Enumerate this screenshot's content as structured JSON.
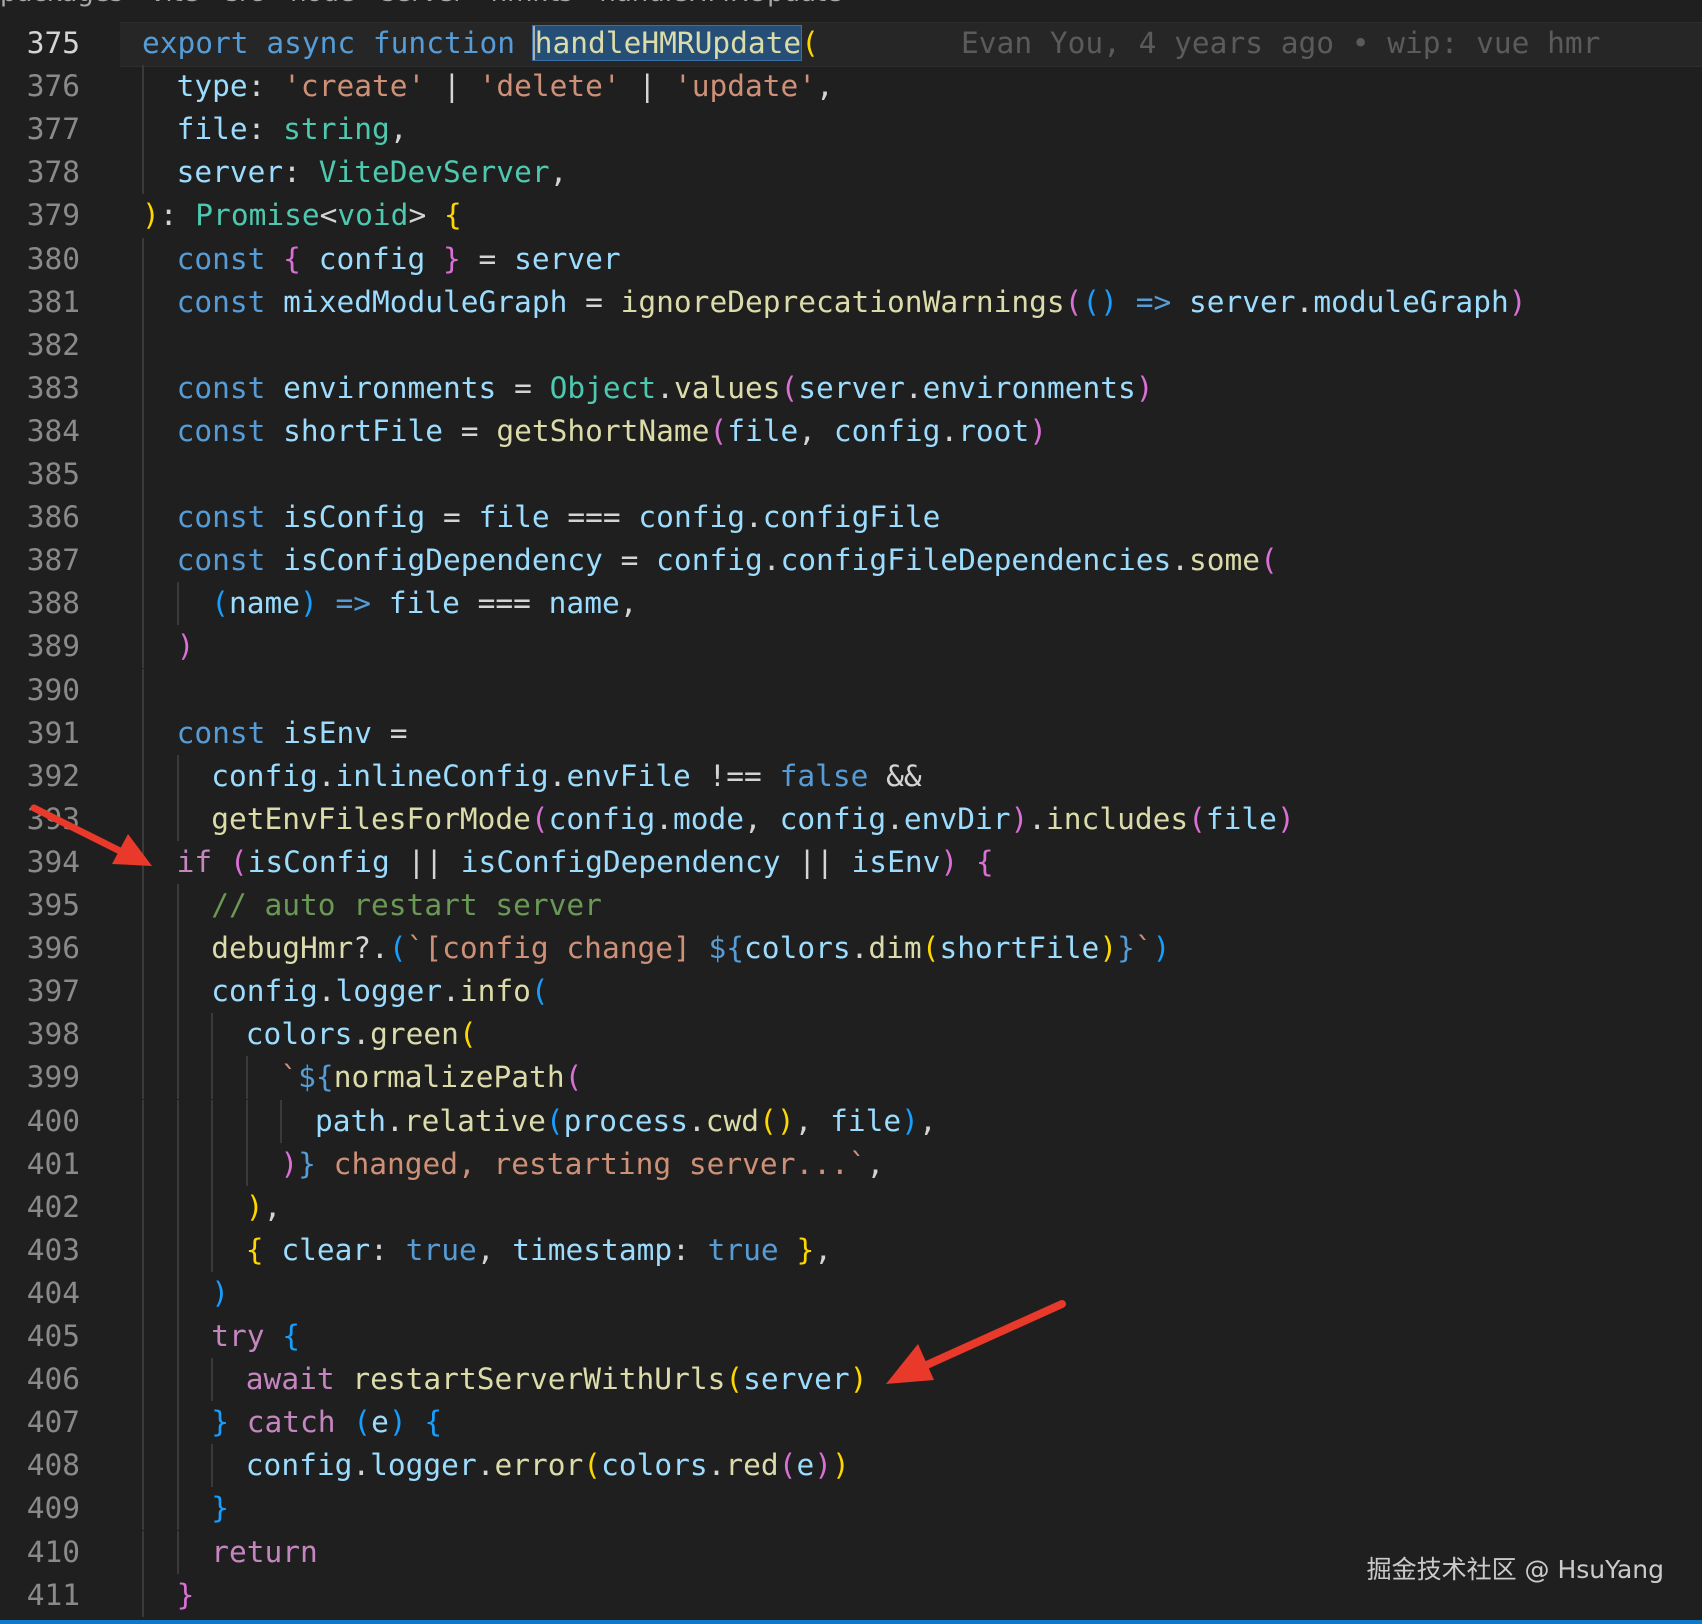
{
  "breadcrumb": {
    "items": [
      "packages",
      "vite",
      "src",
      "node",
      "server",
      "hmr.ts",
      "handleHMRUpdate"
    ]
  },
  "blame": "Evan You, 4 years ago • wip: vue hmr",
  "watermark": "掘金技术社区 @ HsuYang",
  "colors": {
    "keyword": "#569cd6",
    "control": "#c586c0",
    "function": "#dcdcaa",
    "variable": "#9cdcfe",
    "type": "#4ec9b0",
    "string": "#ce9178",
    "comment": "#6a9955",
    "bracket1": "#ffd700",
    "bracket2": "#da70d6",
    "bracket3": "#179fff",
    "arrow": "#e8392b"
  },
  "lines": [
    {
      "n": "375",
      "indent": 0,
      "tokens": [
        [
          "export ",
          "kw"
        ],
        [
          "async ",
          "kw"
        ],
        [
          "function ",
          "kw"
        ],
        [
          "handleHMRUpdate",
          "fnsel"
        ],
        [
          "(",
          "b1"
        ]
      ],
      "blame": true,
      "active": true
    },
    {
      "n": "376",
      "indent": 1,
      "tokens": [
        [
          "type",
          "var"
        ],
        [
          ": ",
          "p"
        ],
        [
          "'create'",
          "str"
        ],
        [
          " | ",
          "p"
        ],
        [
          "'delete'",
          "str"
        ],
        [
          " | ",
          "p"
        ],
        [
          "'update'",
          "str"
        ],
        [
          ",",
          "p"
        ]
      ]
    },
    {
      "n": "377",
      "indent": 1,
      "tokens": [
        [
          "file",
          "var"
        ],
        [
          ": ",
          "p"
        ],
        [
          "string",
          "type"
        ],
        [
          ",",
          "p"
        ]
      ]
    },
    {
      "n": "378",
      "indent": 1,
      "tokens": [
        [
          "server",
          "var"
        ],
        [
          ": ",
          "p"
        ],
        [
          "ViteDevServer",
          "type"
        ],
        [
          ",",
          "p"
        ]
      ]
    },
    {
      "n": "379",
      "indent": 0,
      "tokens": [
        [
          ")",
          "b1"
        ],
        [
          ": ",
          "p"
        ],
        [
          "Promise",
          "type"
        ],
        [
          "<",
          "p"
        ],
        [
          "void",
          "type"
        ],
        [
          "> ",
          "p"
        ],
        [
          "{",
          "b1"
        ]
      ]
    },
    {
      "n": "380",
      "indent": 1,
      "tokens": [
        [
          "const ",
          "kw"
        ],
        [
          "{ ",
          "b2"
        ],
        [
          "config ",
          "var"
        ],
        [
          "}",
          "b2"
        ],
        [
          " = ",
          "p"
        ],
        [
          "server",
          "var"
        ]
      ]
    },
    {
      "n": "381",
      "indent": 1,
      "tokens": [
        [
          "const ",
          "kw"
        ],
        [
          "mixedModuleGraph",
          "var"
        ],
        [
          " = ",
          "p"
        ],
        [
          "ignoreDeprecationWarnings",
          "fn"
        ],
        [
          "(",
          "b2"
        ],
        [
          "()",
          "b3"
        ],
        [
          " => ",
          "kw"
        ],
        [
          "server",
          "var"
        ],
        [
          ".",
          "p"
        ],
        [
          "moduleGraph",
          "var"
        ],
        [
          ")",
          "b2"
        ]
      ]
    },
    {
      "n": "382",
      "indent": 1,
      "tokens": []
    },
    {
      "n": "383",
      "indent": 1,
      "tokens": [
        [
          "const ",
          "kw"
        ],
        [
          "environments",
          "var"
        ],
        [
          " = ",
          "p"
        ],
        [
          "Object",
          "type"
        ],
        [
          ".",
          "p"
        ],
        [
          "values",
          "fn"
        ],
        [
          "(",
          "b2"
        ],
        [
          "server",
          "var"
        ],
        [
          ".",
          "p"
        ],
        [
          "environments",
          "var"
        ],
        [
          ")",
          "b2"
        ]
      ]
    },
    {
      "n": "384",
      "indent": 1,
      "tokens": [
        [
          "const ",
          "kw"
        ],
        [
          "shortFile",
          "var"
        ],
        [
          " = ",
          "p"
        ],
        [
          "getShortName",
          "fn"
        ],
        [
          "(",
          "b2"
        ],
        [
          "file",
          "var"
        ],
        [
          ", ",
          "p"
        ],
        [
          "config",
          "var"
        ],
        [
          ".",
          "p"
        ],
        [
          "root",
          "var"
        ],
        [
          ")",
          "b2"
        ]
      ]
    },
    {
      "n": "385",
      "indent": 1,
      "tokens": []
    },
    {
      "n": "386",
      "indent": 1,
      "tokens": [
        [
          "const ",
          "kw"
        ],
        [
          "isConfig",
          "var"
        ],
        [
          " = ",
          "p"
        ],
        [
          "file",
          "var"
        ],
        [
          " === ",
          "p"
        ],
        [
          "config",
          "var"
        ],
        [
          ".",
          "p"
        ],
        [
          "configFile",
          "var"
        ]
      ]
    },
    {
      "n": "387",
      "indent": 1,
      "tokens": [
        [
          "const ",
          "kw"
        ],
        [
          "isConfigDependency",
          "var"
        ],
        [
          " = ",
          "p"
        ],
        [
          "config",
          "var"
        ],
        [
          ".",
          "p"
        ],
        [
          "configFileDependencies",
          "var"
        ],
        [
          ".",
          "p"
        ],
        [
          "some",
          "fn"
        ],
        [
          "(",
          "b2"
        ]
      ]
    },
    {
      "n": "388",
      "indent": 2,
      "tokens": [
        [
          "(",
          "b3"
        ],
        [
          "name",
          "var"
        ],
        [
          ")",
          "b3"
        ],
        [
          " => ",
          "kw"
        ],
        [
          "file",
          "var"
        ],
        [
          " === ",
          "p"
        ],
        [
          "name",
          "var"
        ],
        [
          ",",
          "p"
        ]
      ]
    },
    {
      "n": "389",
      "indent": 1,
      "tokens": [
        [
          ")",
          "b2"
        ]
      ]
    },
    {
      "n": "390",
      "indent": 1,
      "tokens": []
    },
    {
      "n": "391",
      "indent": 1,
      "tokens": [
        [
          "const ",
          "kw"
        ],
        [
          "isEnv",
          "var"
        ],
        [
          " =",
          "p"
        ]
      ]
    },
    {
      "n": "392",
      "indent": 2,
      "tokens": [
        [
          "config",
          "var"
        ],
        [
          ".",
          "p"
        ],
        [
          "inlineConfig",
          "var"
        ],
        [
          ".",
          "p"
        ],
        [
          "envFile",
          "var"
        ],
        [
          " !== ",
          "p"
        ],
        [
          "false",
          "kw"
        ],
        [
          " &&",
          "p"
        ]
      ]
    },
    {
      "n": "393",
      "indent": 2,
      "tokens": [
        [
          "getEnvFilesForMode",
          "fn"
        ],
        [
          "(",
          "b2"
        ],
        [
          "config",
          "var"
        ],
        [
          ".",
          "p"
        ],
        [
          "mode",
          "var"
        ],
        [
          ", ",
          "p"
        ],
        [
          "config",
          "var"
        ],
        [
          ".",
          "p"
        ],
        [
          "envDir",
          "var"
        ],
        [
          ")",
          "b2"
        ],
        [
          ".",
          "p"
        ],
        [
          "includes",
          "fn"
        ],
        [
          "(",
          "b2"
        ],
        [
          "file",
          "var"
        ],
        [
          ")",
          "b2"
        ]
      ]
    },
    {
      "n": "394",
      "indent": 1,
      "tokens": [
        [
          "if ",
          "ctl"
        ],
        [
          "(",
          "b2"
        ],
        [
          "isConfig",
          "var"
        ],
        [
          " || ",
          "p"
        ],
        [
          "isConfigDependency",
          "var"
        ],
        [
          " || ",
          "p"
        ],
        [
          "isEnv",
          "var"
        ],
        [
          ")",
          "b2"
        ],
        [
          " {",
          "b2"
        ]
      ]
    },
    {
      "n": "395",
      "indent": 2,
      "tokens": [
        [
          "// auto restart server",
          "cm"
        ]
      ]
    },
    {
      "n": "396",
      "indent": 2,
      "tokens": [
        [
          "debugHmr",
          "fn"
        ],
        [
          "?.",
          "p"
        ],
        [
          "(",
          "b3"
        ],
        [
          "`[config change] ",
          "str"
        ],
        [
          "${",
          "kw"
        ],
        [
          "colors",
          "var"
        ],
        [
          ".",
          "p"
        ],
        [
          "dim",
          "fn"
        ],
        [
          "(",
          "b1"
        ],
        [
          "shortFile",
          "var"
        ],
        [
          ")",
          "b1"
        ],
        [
          "}",
          "kw"
        ],
        [
          "`",
          "str"
        ],
        [
          ")",
          "b3"
        ]
      ]
    },
    {
      "n": "397",
      "indent": 2,
      "tokens": [
        [
          "config",
          "var"
        ],
        [
          ".",
          "p"
        ],
        [
          "logger",
          "var"
        ],
        [
          ".",
          "p"
        ],
        [
          "info",
          "fn"
        ],
        [
          "(",
          "b3"
        ]
      ]
    },
    {
      "n": "398",
      "indent": 3,
      "tokens": [
        [
          "colors",
          "var"
        ],
        [
          ".",
          "p"
        ],
        [
          "green",
          "fn"
        ],
        [
          "(",
          "b1"
        ]
      ]
    },
    {
      "n": "399",
      "indent": 4,
      "tokens": [
        [
          "`",
          "str"
        ],
        [
          "${",
          "kw"
        ],
        [
          "normalizePath",
          "fn"
        ],
        [
          "(",
          "b2"
        ]
      ]
    },
    {
      "n": "400",
      "indent": 5,
      "tokens": [
        [
          "path",
          "var"
        ],
        [
          ".",
          "p"
        ],
        [
          "relative",
          "fn"
        ],
        [
          "(",
          "b3"
        ],
        [
          "process",
          "var"
        ],
        [
          ".",
          "p"
        ],
        [
          "cwd",
          "fn"
        ],
        [
          "()",
          "b1"
        ],
        [
          ", ",
          "p"
        ],
        [
          "file",
          "var"
        ],
        [
          ")",
          "b3"
        ],
        [
          ",",
          "p"
        ]
      ]
    },
    {
      "n": "401",
      "indent": 4,
      "tokens": [
        [
          ")",
          "b2"
        ],
        [
          "}",
          "kw"
        ],
        [
          " changed, restarting server...`",
          "str"
        ],
        [
          ",",
          "p"
        ]
      ]
    },
    {
      "n": "402",
      "indent": 3,
      "tokens": [
        [
          ")",
          "b1"
        ],
        [
          ",",
          "p"
        ]
      ]
    },
    {
      "n": "403",
      "indent": 3,
      "tokens": [
        [
          "{ ",
          "b1"
        ],
        [
          "clear",
          "var"
        ],
        [
          ": ",
          "p"
        ],
        [
          "true",
          "kw"
        ],
        [
          ", ",
          "p"
        ],
        [
          "timestamp",
          "var"
        ],
        [
          ": ",
          "p"
        ],
        [
          "true",
          "kw"
        ],
        [
          " }",
          "b1"
        ],
        [
          ",",
          "p"
        ]
      ]
    },
    {
      "n": "404",
      "indent": 2,
      "tokens": [
        [
          ")",
          "b3"
        ]
      ]
    },
    {
      "n": "405",
      "indent": 2,
      "tokens": [
        [
          "try ",
          "ctl"
        ],
        [
          "{",
          "b3"
        ]
      ]
    },
    {
      "n": "406",
      "indent": 3,
      "tokens": [
        [
          "await ",
          "ctl"
        ],
        [
          "restartServerWithUrls",
          "fn"
        ],
        [
          "(",
          "b1"
        ],
        [
          "server",
          "var"
        ],
        [
          ")",
          "b1"
        ]
      ]
    },
    {
      "n": "407",
      "indent": 2,
      "tokens": [
        [
          "} ",
          "b3"
        ],
        [
          "catch ",
          "ctl"
        ],
        [
          "(",
          "b3"
        ],
        [
          "e",
          "var"
        ],
        [
          ") ",
          "b3"
        ],
        [
          "{",
          "b3"
        ]
      ]
    },
    {
      "n": "408",
      "indent": 3,
      "tokens": [
        [
          "config",
          "var"
        ],
        [
          ".",
          "p"
        ],
        [
          "logger",
          "var"
        ],
        [
          ".",
          "p"
        ],
        [
          "error",
          "fn"
        ],
        [
          "(",
          "b1"
        ],
        [
          "colors",
          "var"
        ],
        [
          ".",
          "p"
        ],
        [
          "red",
          "fn"
        ],
        [
          "(",
          "b2"
        ],
        [
          "e",
          "var"
        ],
        [
          ")",
          "b2"
        ],
        [
          ")",
          "b1"
        ]
      ]
    },
    {
      "n": "409",
      "indent": 2,
      "tokens": [
        [
          "}",
          "b3"
        ]
      ]
    },
    {
      "n": "410",
      "indent": 2,
      "tokens": [
        [
          "return",
          "ctl"
        ]
      ]
    },
    {
      "n": "411",
      "indent": 1,
      "tokens": [
        [
          "}",
          "b2"
        ]
      ]
    }
  ]
}
